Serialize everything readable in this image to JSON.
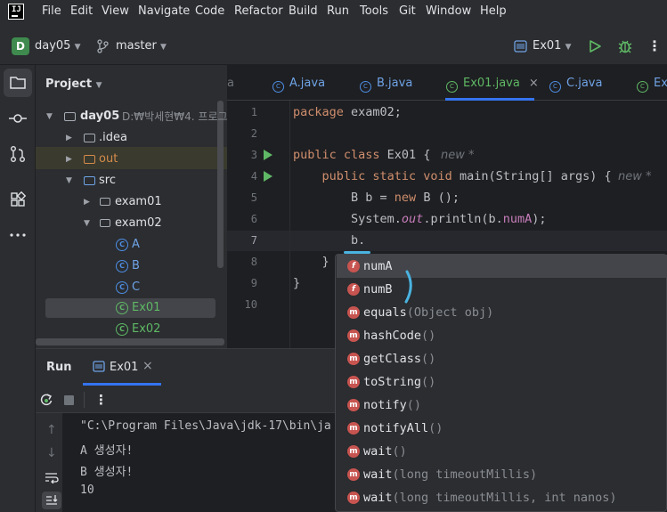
{
  "menu": [
    "File",
    "Edit",
    "View",
    "Navigate",
    "Code",
    "Refactor",
    "Build",
    "Run",
    "Tools",
    "Git",
    "Window",
    "Help"
  ],
  "toolbar": {
    "project_badge": "D",
    "project": "day05",
    "branch": "master",
    "run_config": "Ex01"
  },
  "project_panel": {
    "title": "Project",
    "tree": [
      {
        "label": "day05",
        "path": "D:₩박세현₩4. 프로그"
      },
      {
        "label": ".idea"
      },
      {
        "label": "out"
      },
      {
        "label": "src"
      },
      {
        "label": "exam01"
      },
      {
        "label": "exam02"
      },
      {
        "label": "A"
      },
      {
        "label": "B"
      },
      {
        "label": "C"
      },
      {
        "label": "Ex01"
      },
      {
        "label": "Ex02"
      }
    ]
  },
  "tabs": [
    {
      "label": "a"
    },
    {
      "label": "A.java"
    },
    {
      "label": "B.java"
    },
    {
      "label": "Ex01.java"
    },
    {
      "label": "C.java"
    },
    {
      "label": "Ex0"
    }
  ],
  "editor": {
    "line_numbers": [
      "1",
      "2",
      "3",
      "4",
      "5",
      "6",
      "7",
      "8",
      "9",
      "10"
    ],
    "hint_new": "new *"
  },
  "completion": {
    "items": [
      {
        "kind": "field",
        "name": "numA",
        "sig": ""
      },
      {
        "kind": "field",
        "name": "numB",
        "sig": ""
      },
      {
        "kind": "method",
        "name": "equals",
        "sig": "(Object obj)"
      },
      {
        "kind": "method",
        "name": "hashCode",
        "sig": "()"
      },
      {
        "kind": "method",
        "name": "getClass",
        "sig": "()"
      },
      {
        "kind": "method",
        "name": "toString",
        "sig": "()"
      },
      {
        "kind": "method",
        "name": "notify",
        "sig": "()"
      },
      {
        "kind": "method",
        "name": "notifyAll",
        "sig": "()"
      },
      {
        "kind": "method",
        "name": "wait",
        "sig": "()"
      },
      {
        "kind": "method",
        "name": "wait",
        "sig": "(long timeoutMillis)"
      },
      {
        "kind": "method",
        "name": "wait",
        "sig": "(long timeoutMillis, int nanos)"
      }
    ]
  },
  "run_panel": {
    "title": "Run",
    "tab": "Ex01",
    "output": [
      "\"C:\\Program Files\\Java\\jdk-17\\bin\\ja",
      "A 생성자!",
      "B 생성자!",
      "10"
    ]
  },
  "colors": {
    "accent": "#3574f0",
    "run_green": "#5fb865",
    "keyword": "#cf8e6d",
    "field": "#c77dbb"
  }
}
